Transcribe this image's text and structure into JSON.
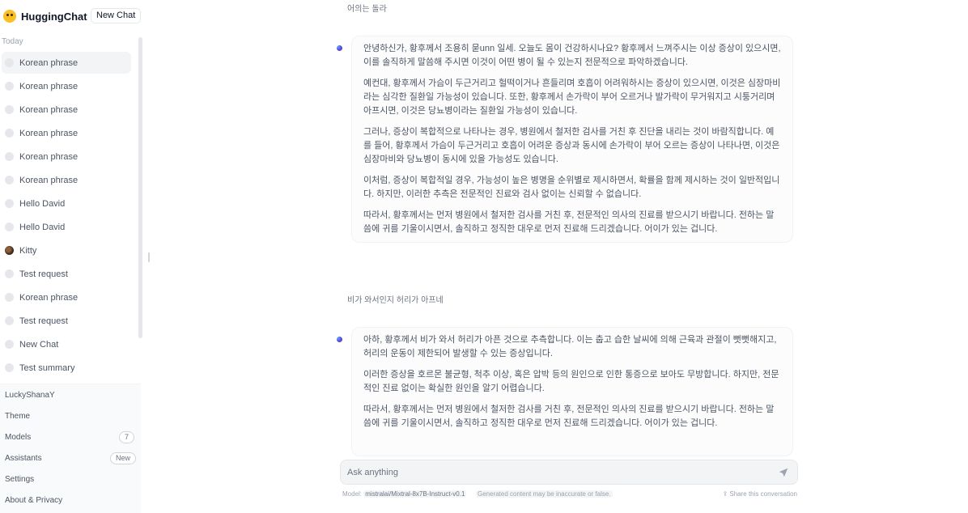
{
  "app": {
    "name": "HuggingChat",
    "new_chat_label": "New Chat"
  },
  "sidebar": {
    "section_label": "Today",
    "conversations": [
      {
        "label": "Korean phrase",
        "icon": "dot"
      },
      {
        "label": "Korean phrase",
        "icon": "dot"
      },
      {
        "label": "Korean phrase",
        "icon": "dot"
      },
      {
        "label": "Korean phrase",
        "icon": "dot"
      },
      {
        "label": "Korean phrase",
        "icon": "dot"
      },
      {
        "label": "Korean phrase",
        "icon": "dot"
      },
      {
        "label": "Hello David",
        "icon": "dot"
      },
      {
        "label": "Hello David",
        "icon": "dot"
      },
      {
        "label": "Kitty",
        "icon": "cat-avatar"
      },
      {
        "label": "Test request",
        "icon": "dot"
      },
      {
        "label": "Korean phrase",
        "icon": "dot"
      },
      {
        "label": "Test request",
        "icon": "dot"
      },
      {
        "label": "New Chat",
        "icon": "dot"
      },
      {
        "label": "Test summary",
        "icon": "dot"
      }
    ],
    "user": "LuckyShanaY",
    "theme_label": "Theme",
    "models_label": "Models",
    "models_count": "7",
    "assistants_label": "Assistants",
    "assistants_badge": "New",
    "settings_label": "Settings",
    "about_label": "About & Privacy"
  },
  "chat": {
    "prompt_top": "어의는 돌라",
    "answer_1": [
      "안녕하신가, 황후께서 조용히 묻unn 일세. 오늘도 몸이 건강하시나요? 황후께서 느껴주시는 이상 증상이 있으시면, 이를 솔직하게 말씀해 주시면 이것이 어떤 병이 될 수 있는지 전문적으로 파악하겠습니다.",
      "예컨대, 황후께서 가슴이 두근거리고 헐떡이거나 흔들리며 호흡이 어려워하시는 증상이 있으시면, 이것은 심장마비라는 심각한 질환일 가능성이 있습니다. 또한, 황후께서 손가락이 부어 오르거나 발가락이 무거워지고 시퉁거리며 아프시면, 이것은 당뇨병이라는 질환일 가능성이 있습니다.",
      "그러나, 증상이 복합적으로 나타나는 경우, 병원에서 철저한 검사를 거친 후 진단을 내리는 것이 바람직합니다. 예를 들어, 황후께서 가슴이 두근거리고 호흡이 어려운 증상과 동시에 손가락이 부어 오르는 증상이 나타나면, 이것은 심장마비와 당뇨병이 동시에 있을 가능성도 있습니다.",
      "이처럼, 증상이 복합적일 경우, 가능성이 높은 병명을 순위별로 제시하면서, 확률을 함께 제시하는 것이 일반적입니다. 하지만, 이러한 추측은 전문적인 진료와 검사 없이는 신뢰할 수 없습니다.",
      "따라서, 황후께서는 먼저 병원에서 철저한 검사를 거친 후, 전문적인 의사의 진료를 받으시기 바랍니다. 전하는 말씀에 귀를 기울이시면서, 솔직하고 정직한 대우로 먼저 진료해 드리겠습니다. 어이가 있는 겁니다."
    ],
    "prompt_2": "비가 와서인지 허리가 아프네",
    "answer_2": [
      "아하, 황후께서 비가 와서 허리가 아픈 것으로 추측합니다. 이는 춥고 습한 날씨에 의해 근육과 관절이 뻣뻣해지고, 허리의 운동이 제한되어 발생할 수 있는 증상입니다.",
      "이러한 증상을 호르몬 불균형, 척추 이상, 혹은 압박 등의 원인으로 인한 통증으로 보아도 무방합니다. 하지만, 전문적인 진료 없이는 확실한 원인을 알기 어렵습니다.",
      "따라서, 황후께서는 먼저 병원에서 철저한 검사를 거친 후, 전문적인 의사의 진료를 받으시기 바랍니다. 전하는 말씀에 귀를 기울이시면서, 솔직하고 정직한 대우로 먼저 진료해 드리겠습니다. 어이가 있는 겁니다."
    ]
  },
  "input": {
    "placeholder": "Ask anything"
  },
  "footer": {
    "model_prefix": "Model:",
    "model_name": "mistralai/Mixtral-8x7B-Instruct-v0.1",
    "disclaimer": "Generated content may be inaccurate or false.",
    "share_label": "Share this conversation"
  }
}
